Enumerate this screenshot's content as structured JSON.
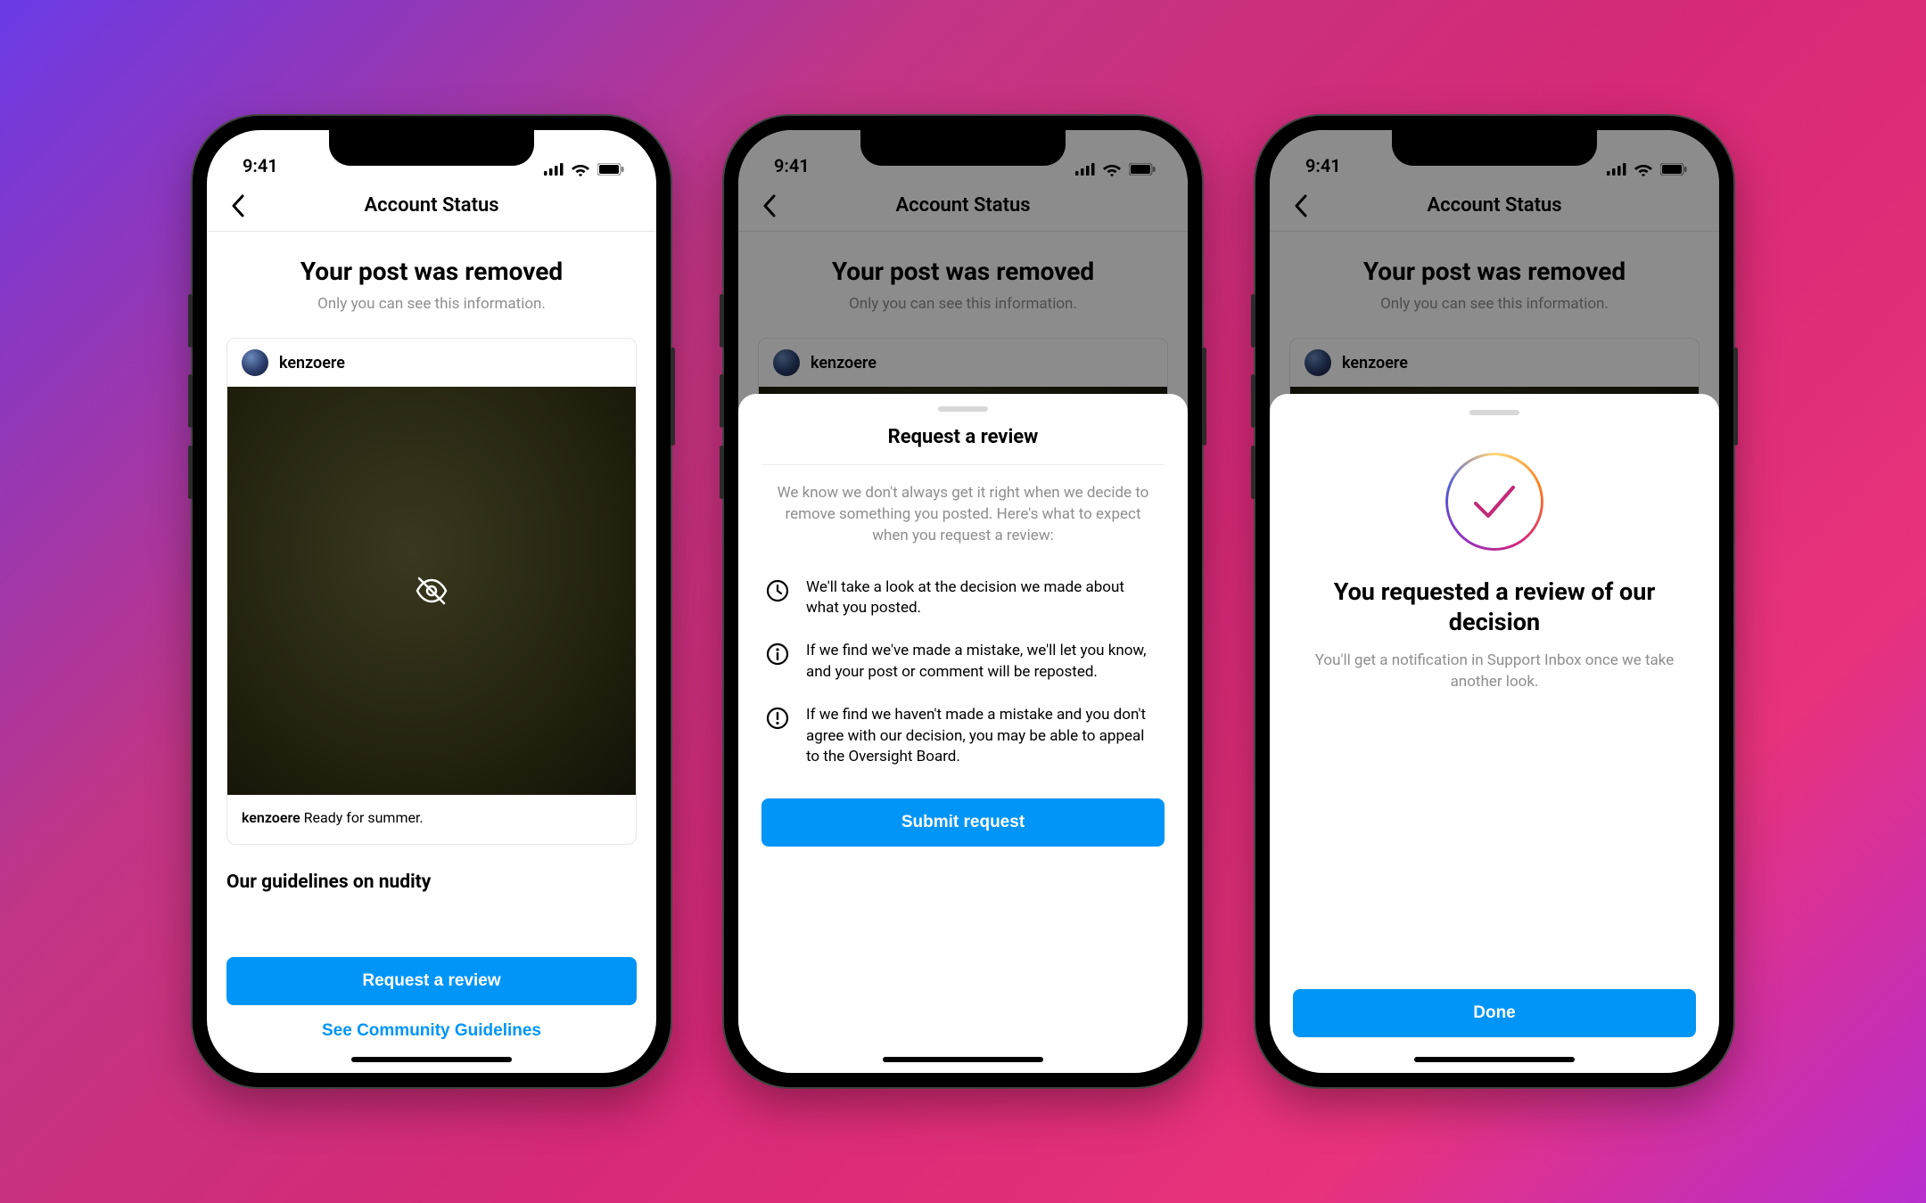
{
  "statusbar": {
    "time": "9:41"
  },
  "nav": {
    "title": "Account Status"
  },
  "removed": {
    "heading": "Your post was removed",
    "subtitle": "Only you can see this information."
  },
  "post": {
    "username": "kenzoere",
    "caption_user": "kenzoere",
    "caption_text": "Ready for summer."
  },
  "guidelines_heading": "Our guidelines on nudity",
  "buttons": {
    "request_review": "Request a review",
    "see_guidelines": "See Community Guidelines",
    "submit_request": "Submit request",
    "done": "Done"
  },
  "review_sheet": {
    "title": "Request a review",
    "intro": "We know we don't always get it right when we decide to remove something you posted. Here's what to expect when you request a review:",
    "items": [
      "We'll take a look at the decision we made about what you posted.",
      "If we find we've made a mistake, we'll let you know, and your post or comment will be reposted.",
      "If we find we haven't made a mistake and you don't agree with our decision, you may be able to appeal to the Oversight Board."
    ]
  },
  "confirm_sheet": {
    "title": "You requested a review of our decision",
    "subtitle": "You'll get a notification in Support Inbox once we take another look."
  }
}
